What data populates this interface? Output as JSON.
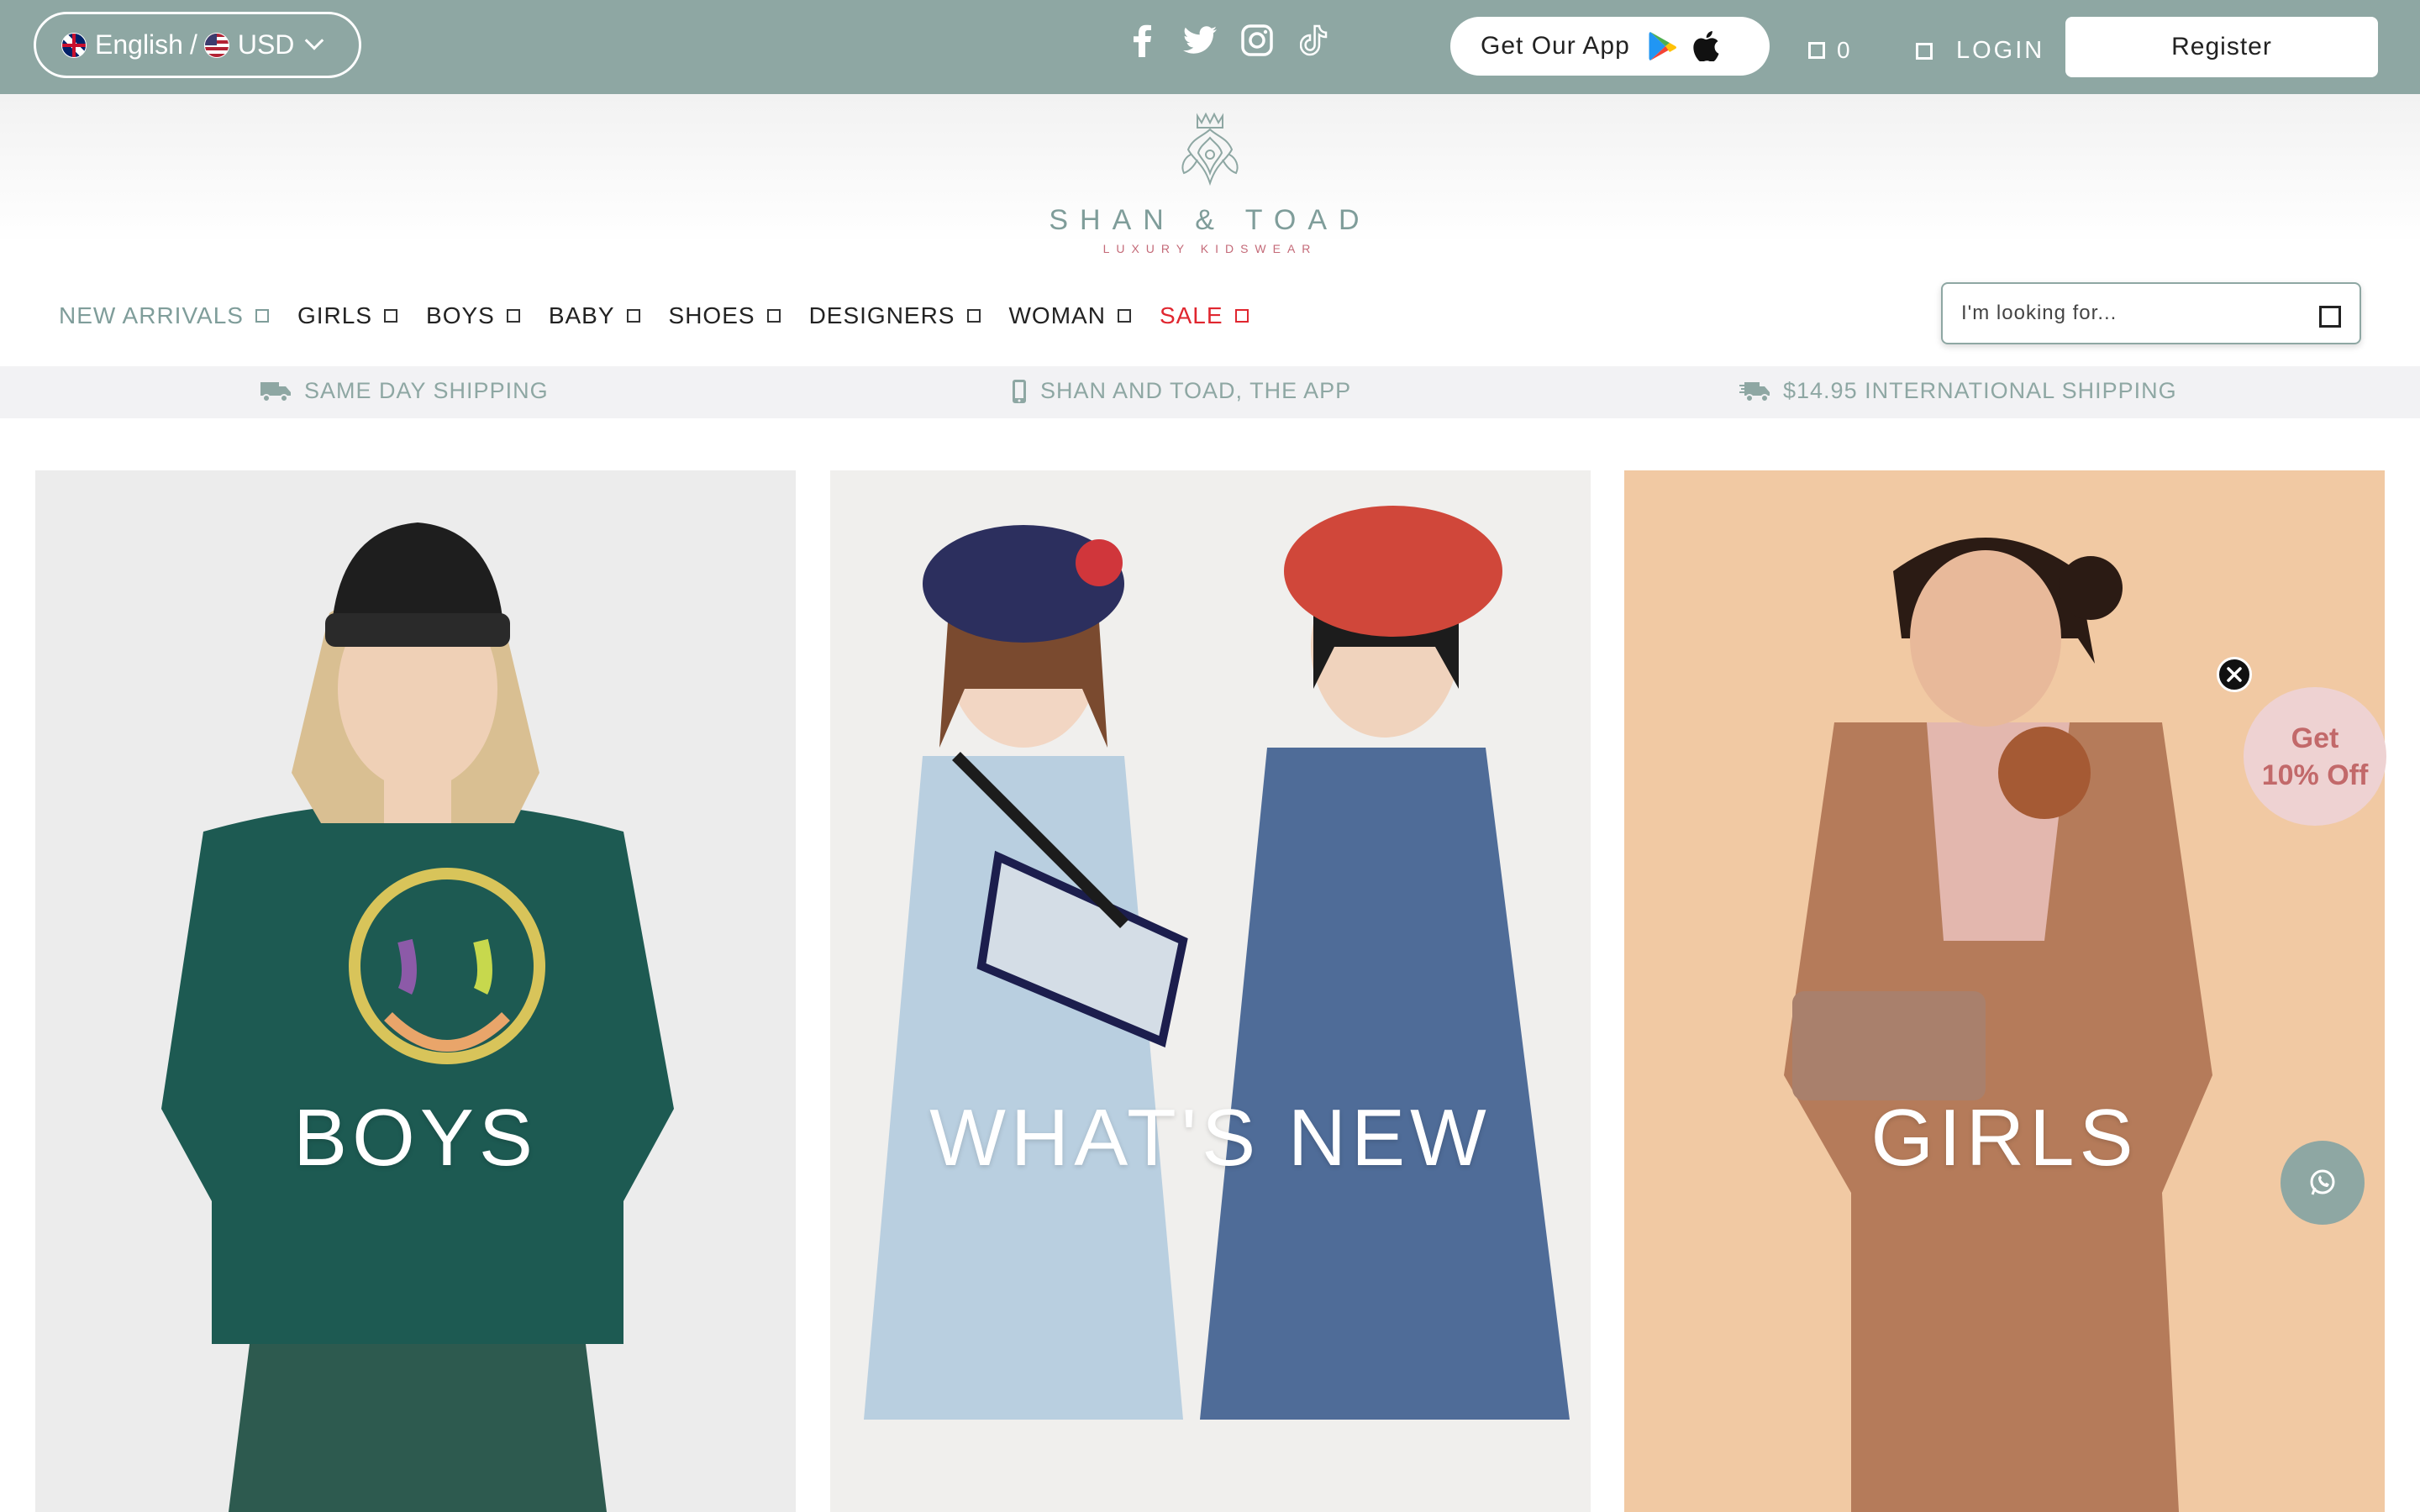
{
  "topbar": {
    "language": "English",
    "separator": "/",
    "currency": "USD",
    "socials": [
      "facebook-icon",
      "twitter-icon",
      "instagram-icon",
      "tiktok-icon"
    ],
    "app_label": "Get Our App",
    "cart_count": "0",
    "login_label": "LOGIN",
    "register_label": "Register"
  },
  "brand": {
    "name": "SHAN & TOAD",
    "tagline": "LUXURY KIDSWEAR"
  },
  "nav": {
    "items": [
      {
        "label": "NEW ARRIVALS"
      },
      {
        "label": "GIRLS"
      },
      {
        "label": "BOYS"
      },
      {
        "label": "BABY"
      },
      {
        "label": "SHOES"
      },
      {
        "label": "DESIGNERS"
      },
      {
        "label": "WOMAN"
      },
      {
        "label": "SALE"
      }
    ]
  },
  "search": {
    "placeholder": "I'm looking for..."
  },
  "perks": [
    {
      "icon": "truck-icon",
      "label": "SAME DAY SHIPPING"
    },
    {
      "icon": "phone-icon",
      "label": "SHAN AND TOAD, THE APP"
    },
    {
      "icon": "fast-truck-icon",
      "label": "$14.95 INTERNATIONAL SHIPPING"
    }
  ],
  "tiles": [
    {
      "label": "BOYS"
    },
    {
      "label": "WHAT'S NEW"
    },
    {
      "label": "GIRLS"
    }
  ],
  "popup": {
    "line1": "Get",
    "line2": "10% Off"
  },
  "colors": {
    "accent": "#8ea7a3",
    "sale": "#e0262f",
    "discount_bg": "#eed2d2",
    "discount_text": "#c2696a"
  }
}
